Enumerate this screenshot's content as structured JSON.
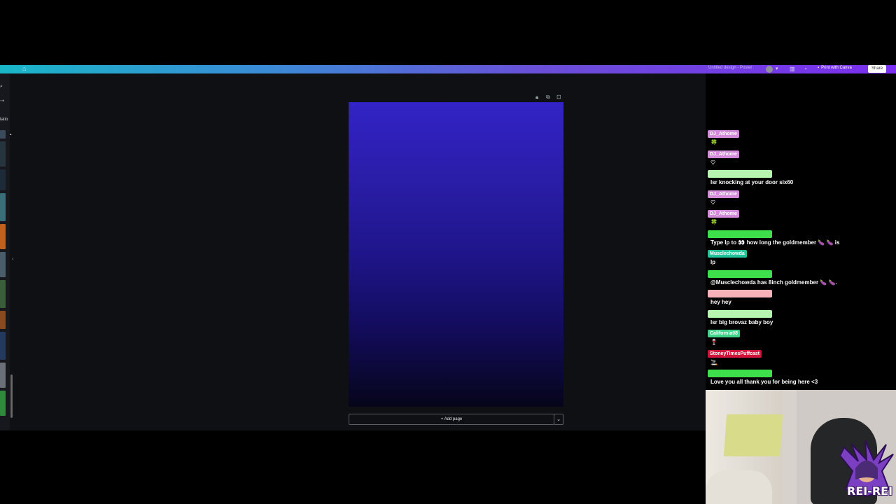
{
  "topbar": {
    "design_title": "Untitled design - Poster",
    "print_label": "Print with Canva",
    "share_label": "Share",
    "gradient": [
      "#19b6c8",
      "#7b2ff0"
    ]
  },
  "left_rail": {
    "apps_label": "tatio"
  },
  "editor": {
    "page_gradient_top": "#3223c6",
    "page_gradient_bottom": "#06051a",
    "add_page_label": "+ Add page"
  },
  "chat": {
    "messages": [
      {
        "user": "DJ_Athome",
        "color": "#d48bd9",
        "text": "🍀"
      },
      {
        "user": "DJ_Athome",
        "color": "#d48bd9",
        "text": "♡"
      },
      {
        "user": "",
        "color": "#b6f5b0",
        "text": "lsr knocking at your door six60"
      },
      {
        "user": "DJ_Athome",
        "color": "#d48bd9",
        "text": "♡"
      },
      {
        "user": "DJ_Athome",
        "color": "#d48bd9",
        "text": "🍀"
      },
      {
        "user": "",
        "color": "#3de04a",
        "text": "Type lp to 👀 how long the goldmember 🍆 🍆 is"
      },
      {
        "user": "Musclechowda",
        "color": "#21c49a",
        "text": "lp"
      },
      {
        "user": "",
        "color": "#3de04a",
        "text": "@Musclechowda has 8inch goldmember 🍆 🍆."
      },
      {
        "user": "",
        "color": "#f6b2b8",
        "text": "hey hey"
      },
      {
        "user": "",
        "color": "#b6f5b0",
        "text": "lsr big brovaz baby boy"
      },
      {
        "user": "California08",
        "color": "#3ed48a",
        "text": "🍷"
      },
      {
        "user": "StoneyTimesPuffcast",
        "color": "#d0153a",
        "text": "🚬"
      },
      {
        "user": "",
        "color": "#3de04a",
        "text": "Love you all thank you for being here <3"
      }
    ]
  },
  "webcam": {
    "overlay_text": "REI-REI"
  }
}
